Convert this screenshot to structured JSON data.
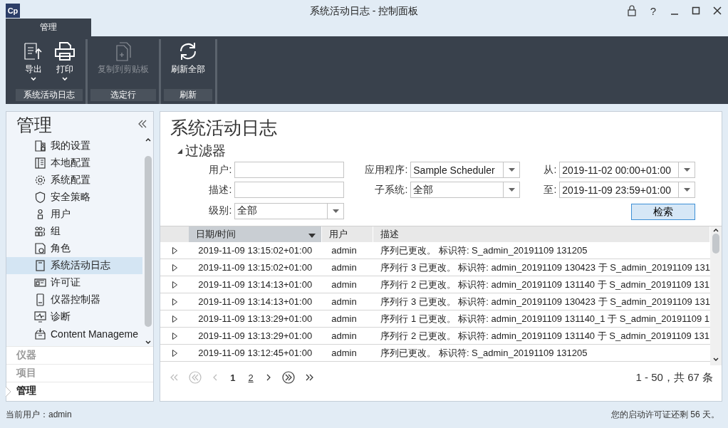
{
  "window": {
    "app_icon": "Cp",
    "title": "系统活动日志 - 控制面板",
    "help": "?"
  },
  "ribbon": {
    "tabs": [
      {
        "label": "管理",
        "selected": true
      }
    ],
    "groups": [
      {
        "label": "系统活动日志",
        "buttons": [
          {
            "label": "导出",
            "kind": "export",
            "dropdown": true,
            "disabled": false
          },
          {
            "label": "打印",
            "kind": "print",
            "dropdown": true,
            "disabled": false
          }
        ]
      },
      {
        "label": "选定行",
        "buttons": [
          {
            "label": "复制到剪贴板",
            "kind": "copy",
            "dropdown": false,
            "disabled": true
          }
        ]
      },
      {
        "label": "刷新",
        "buttons": [
          {
            "label": "刷新全部",
            "kind": "refresh",
            "dropdown": false,
            "disabled": false
          }
        ]
      }
    ]
  },
  "sidebar": {
    "title": "管理",
    "items": [
      {
        "label": "我的设置",
        "kind": "settings",
        "selected": false
      },
      {
        "label": "本地配置",
        "kind": "panel",
        "selected": false
      },
      {
        "label": "系统配置",
        "kind": "gear",
        "selected": false
      },
      {
        "label": "安全策略",
        "kind": "shield",
        "selected": false
      },
      {
        "label": "用户",
        "kind": "user",
        "selected": false
      },
      {
        "label": "组",
        "kind": "group",
        "selected": false
      },
      {
        "label": "角色",
        "kind": "role",
        "selected": false
      },
      {
        "label": "系统活动日志",
        "kind": "log",
        "selected": true
      },
      {
        "label": "许可证",
        "kind": "license",
        "selected": false
      },
      {
        "label": "仪器控制器",
        "kind": "device",
        "selected": false
      },
      {
        "label": "诊断",
        "kind": "monitor",
        "selected": false
      },
      {
        "label": "Content Manageme",
        "kind": "inbox",
        "selected": false
      }
    ],
    "sections": [
      {
        "label": "仪器",
        "selected": false
      },
      {
        "label": "项目",
        "selected": false
      },
      {
        "label": "管理",
        "selected": true
      }
    ]
  },
  "content": {
    "title": "系统活动日志",
    "filter": {
      "title": "过滤器",
      "expanded": true,
      "fields": [
        {
          "label": "用户:",
          "kind": "text"
        },
        {
          "label": "应用程序:",
          "kind": "select",
          "value": "Sample Scheduler"
        },
        {
          "label": "从:",
          "kind": "select",
          "value": "2019-11-02 00:00+01:00"
        },
        {
          "label": "描述:",
          "kind": "text"
        },
        {
          "label": "子系统:",
          "kind": "select",
          "value": "全部"
        },
        {
          "label": "至:",
          "kind": "select",
          "value": "2019-11-09 23:59+01:00"
        },
        {
          "label": "级别:",
          "kind": "select",
          "value": "全部"
        }
      ],
      "search_button": "检索"
    },
    "table": {
      "columns": [
        {
          "label": "日期/时间",
          "sorted": true
        },
        {
          "label": "用户",
          "sorted": false
        },
        {
          "label": "描述",
          "sorted": false
        }
      ],
      "rows": [
        {
          "datetime": "2019-11-09 13:15:02+01:00",
          "user": "admin",
          "description": "序列已更改。 标识符: S_admin_20191109 131205",
          "expanded": false
        },
        {
          "datetime": "2019-11-09 13:15:02+01:00",
          "user": "admin",
          "description": "序列行 3 已更改。 标识符: admin_20191109 130423 于 S_admin_20191109 131",
          "expanded": false
        },
        {
          "datetime": "2019-11-09 13:14:13+01:00",
          "user": "admin",
          "description": "序列行 2 已更改。 标识符: admin_20191109 131140 于 S_admin_20191109 131",
          "expanded": false
        },
        {
          "datetime": "2019-11-09 13:14:13+01:00",
          "user": "admin",
          "description": "序列行 3 已更改。 标识符: admin_20191109 130423 于 S_admin_20191109 131",
          "expanded": false
        },
        {
          "datetime": "2019-11-09 13:13:29+01:00",
          "user": "admin",
          "description": "序列行 1 已更改。 标识符: admin_20191109 131140_1 于 S_admin_20191109 1",
          "expanded": false
        },
        {
          "datetime": "2019-11-09 13:13:29+01:00",
          "user": "admin",
          "description": "序列行 2 已更改。 标识符: admin_20191109 131140 于 S_admin_20191109 131",
          "expanded": false
        },
        {
          "datetime": "2019-11-09 13:12:45+01:00",
          "user": "admin",
          "description": "序列已更改。 标识符: S_admin_20191109 131205",
          "expanded": false
        }
      ]
    },
    "pager": {
      "nav_before": [
        {
          "kind": "first",
          "disabled": true
        },
        {
          "kind": "prev-group",
          "disabled": true
        },
        {
          "kind": "prev",
          "disabled": true
        }
      ],
      "pages": [
        {
          "label": "1",
          "selected": true
        },
        {
          "label": "2",
          "selected": false
        }
      ],
      "nav_after": [
        {
          "kind": "next",
          "disabled": false
        },
        {
          "kind": "next-group",
          "disabled": false
        },
        {
          "kind": "last",
          "disabled": false
        }
      ],
      "summary": "1 - 50，共 67 条"
    }
  },
  "status_bar": {
    "user": "当前用户：admin",
    "license": "您的启动许可证还剩 56 天。"
  }
}
